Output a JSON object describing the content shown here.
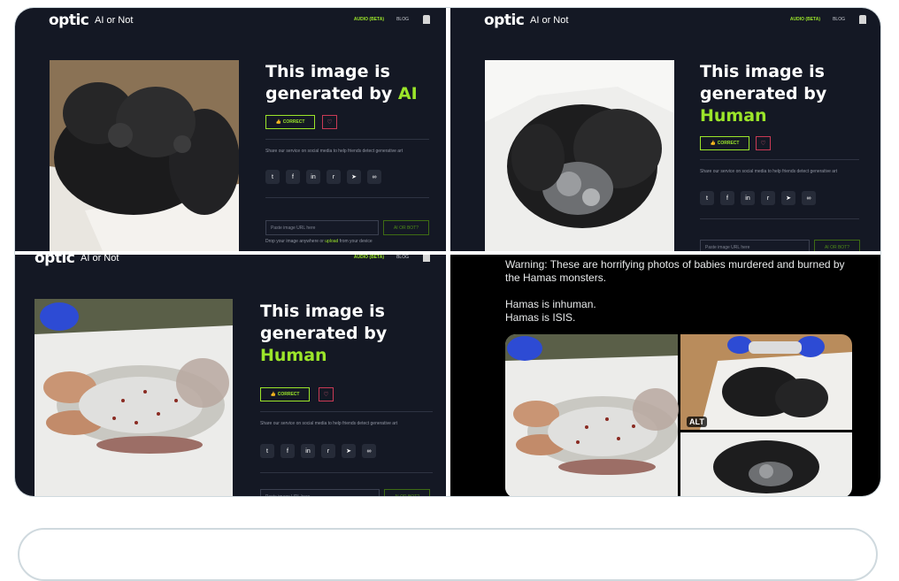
{
  "optic": {
    "logo": "optic",
    "subtitle": "AI or Not",
    "nav_audio": "AUDIO (BETA)",
    "nav_blog": "BLOG",
    "verdict_prefix": "This image is generated by",
    "verdict_ai": "AI",
    "verdict_human": "Human",
    "correct_label": "CORRECT",
    "share_text": "Share our service on social media to help friends detect generative art",
    "url_placeholder": "Paste image URL here",
    "ai_button": "AI OR BOT?",
    "drop_text_before": "Drop your image anywhere or",
    "drop_link": "upload",
    "drop_text_after": "from your device",
    "social_icons": [
      "twitter-icon",
      "facebook-icon",
      "linkedin-icon",
      "reddit-icon",
      "telegram-icon",
      "link-icon"
    ]
  },
  "tweet": {
    "text": "Warning: These are horrifying photos of babies murdered and burned by the Hamas monsters.\n\nHamas is inhuman.\nHamas is ISIS.",
    "alt_badge": "ALT"
  },
  "colors": {
    "accent_green": "#9be52a",
    "heart_red": "#c93a55",
    "panel_bg": "#141824"
  }
}
